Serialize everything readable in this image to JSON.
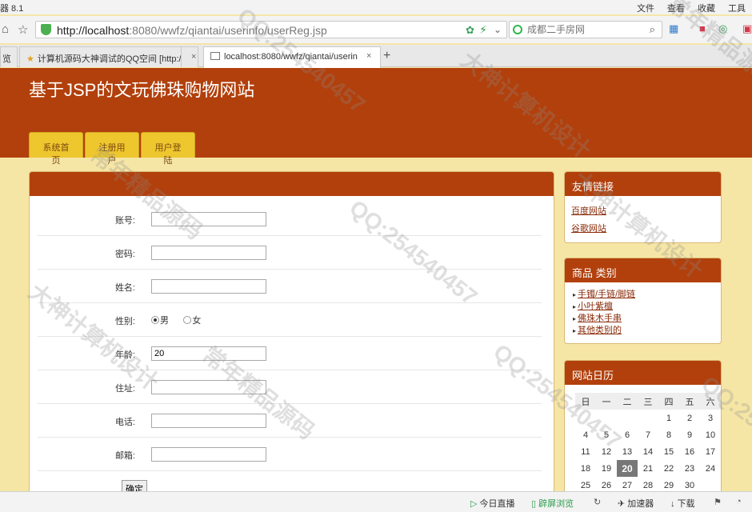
{
  "browser": {
    "title_fragment": "器 8.1",
    "menu": [
      "文件",
      "查看",
      "收藏",
      "工具"
    ],
    "url_host": "http://localhost",
    "url_rest": ":8080/wwfz/qiantai/userinfo/userReg.jsp",
    "search_placeholder": "成都二手房网",
    "tabs": [
      {
        "label": "览"
      },
      {
        "label": "计算机源码大神调试的QQ空间 [http:/"
      },
      {
        "label": "localhost:8080/wwfz/qiantai/userin"
      }
    ],
    "tab_close": "×",
    "new_tab": "+"
  },
  "site": {
    "title": "基于JSP的文玩佛珠购物网站",
    "nav": [
      "系统首页",
      "注册用户",
      "用户登陆"
    ]
  },
  "form": {
    "fields": [
      {
        "label": "账号:",
        "value": ""
      },
      {
        "label": "密码:",
        "value": ""
      },
      {
        "label": "姓名:",
        "value": ""
      }
    ],
    "gender_label": "性别:",
    "gender_male": "男",
    "gender_female": "女",
    "gender_selected": "男",
    "age_label": "年龄:",
    "age_value": "20",
    "fields2": [
      {
        "label": "住址:",
        "value": ""
      },
      {
        "label": "电话:",
        "value": ""
      },
      {
        "label": "邮箱:",
        "value": ""
      }
    ],
    "submit": "确定"
  },
  "sidebar": {
    "links_title": "友情链接",
    "links": [
      "百度网站",
      "谷歌网站"
    ],
    "category_title": "商品 类别",
    "categories": [
      "手镯/手链/脚链",
      "小叶紫檀",
      "佛珠木手串",
      "其他类别的"
    ],
    "calendar_title": "网站日历",
    "weekdays": [
      "日",
      "一",
      "二",
      "三",
      "四",
      "五",
      "六"
    ],
    "weeks": [
      [
        "",
        "",
        "",
        "",
        "1",
        "2",
        "3"
      ],
      [
        "4",
        "5",
        "6",
        "7",
        "8",
        "9",
        "10"
      ],
      [
        "11",
        "12",
        "13",
        "14",
        "15",
        "16",
        "17"
      ],
      [
        "18",
        "19",
        "20",
        "21",
        "22",
        "23",
        "24"
      ],
      [
        "25",
        "26",
        "27",
        "28",
        "29",
        "30",
        ""
      ]
    ],
    "today": "20"
  },
  "statusbar": {
    "items": [
      "今日直播",
      "辟屏浏览",
      "加速器",
      "下载"
    ]
  },
  "watermark": {
    "texts": [
      "QQ:254540457",
      "大神计算机设计",
      "常年精品源码"
    ]
  },
  "colors": {
    "brand": "#b2400c",
    "nav_tab": "#eec62e",
    "page_bg": "#f6e6a6"
  }
}
